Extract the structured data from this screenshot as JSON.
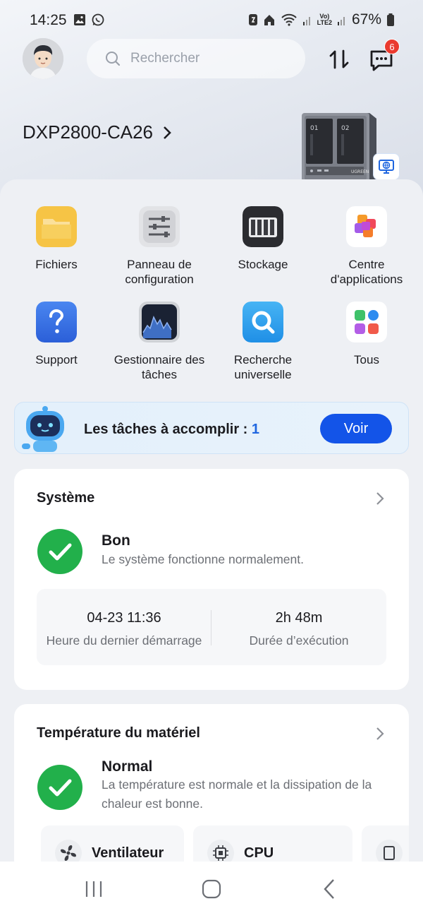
{
  "status_bar": {
    "time": "14:25",
    "volte_label": "Vo)",
    "lte_label": "LTE2",
    "battery": "67%"
  },
  "header": {
    "search_placeholder": "Rechercher",
    "notification_count": "6"
  },
  "device": {
    "name": "DXP2800-CA26",
    "bay_labels": [
      "01",
      "02"
    ],
    "brand": "UGREEN"
  },
  "apps": [
    {
      "label": "Fichiers",
      "icon": "folder-icon"
    },
    {
      "label": "Panneau de configuration",
      "icon": "sliders-icon"
    },
    {
      "label": "Stockage",
      "icon": "storage-icon"
    },
    {
      "label": "Centre d'applications",
      "icon": "app-center-icon"
    },
    {
      "label": "Support",
      "icon": "question-icon"
    },
    {
      "label": "Gestionnaire des tâches",
      "icon": "task-manager-icon"
    },
    {
      "label": "Recherche universelle",
      "icon": "search-icon"
    },
    {
      "label": "Tous",
      "icon": "all-apps-icon"
    }
  ],
  "tasks": {
    "label": "Les tâches à accomplir : ",
    "count": "1",
    "button": "Voir"
  },
  "system_card": {
    "title": "Système",
    "status": "Bon",
    "description": "Le système fonctionne normalement.",
    "last_boot_value": "04-23 11:36",
    "last_boot_label": "Heure du dernier démarrage",
    "uptime_value": "2h 48m",
    "uptime_label": "Durée d’exécution"
  },
  "temp_card": {
    "title": "Température du matériel",
    "status": "Normal",
    "description": "La température est normale et la dissipation de la chaleur est bonne.",
    "fan_label": "Ventilateur",
    "cpu_label": "CPU"
  },
  "colors": {
    "accent": "#1354e8",
    "ok": "#22b04b",
    "badge": "#ea3a2f"
  }
}
